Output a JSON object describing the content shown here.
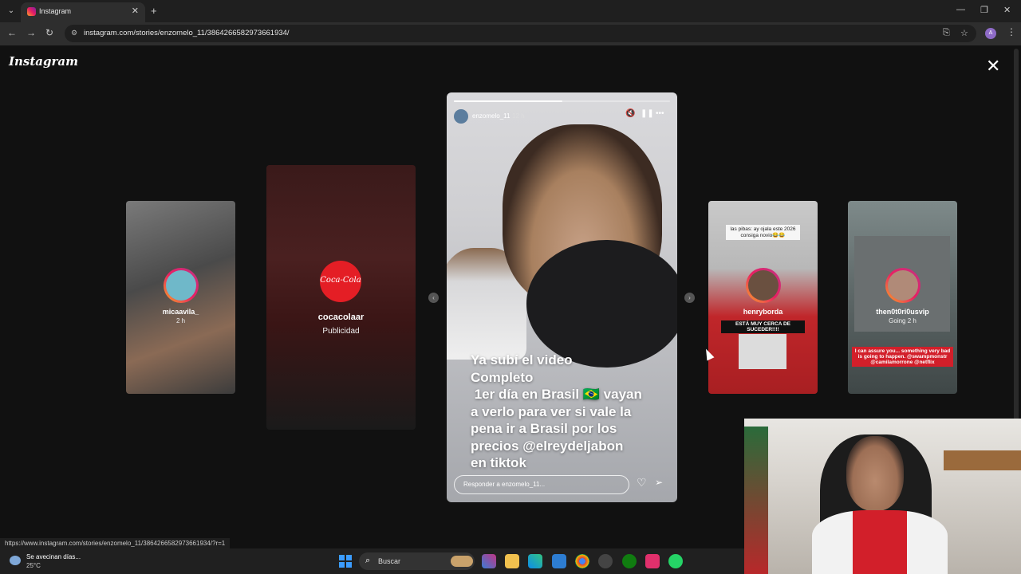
{
  "browser": {
    "tab_title": "Instagram",
    "url": "instagram.com/stories/enzomelo_11/3864266582973661934/",
    "status_url": "https://www.instagram.com/stories/enzomelo_11/3864266582973661934/?r=1"
  },
  "instagram": {
    "logo": "Instagram",
    "previews": [
      {
        "user": "micaavila_",
        "time": "2 h"
      },
      {
        "user": "cocacolaar",
        "time": "Publicidad",
        "logo_text": "Coca-Cola"
      },
      {
        "user": "henryborda",
        "time": "",
        "overlay_top": "las pibas: ay ojala este 2026 consiga novio😂😂",
        "overlay_banner": "ESTÁ MUY CERCA DE SUCEDER!!!!"
      },
      {
        "user": "then0t0ri0usvip",
        "time": "Going 2 h",
        "overlay_text": "I can assure you... something very bad is going to happen. @swampmonstr @camilamorrone @netflix"
      }
    ],
    "story": {
      "user": "enzomelo_11",
      "time": "12 h",
      "progress": 0.5,
      "caption": [
        "Ya subí el video",
        "Completo",
        " 1er día en Brasil 🇧🇷 vayan",
        "a verlo para ver si vale la",
        "pena ir a Brasil por los",
        "precios @elreydeljabon",
        "en tiktok"
      ],
      "reply_placeholder": "Responder a enzomelo_11..."
    }
  },
  "taskbar": {
    "weather_title": "Se avecinan días...",
    "weather_temp": "25°C",
    "search_label": "Buscar"
  }
}
